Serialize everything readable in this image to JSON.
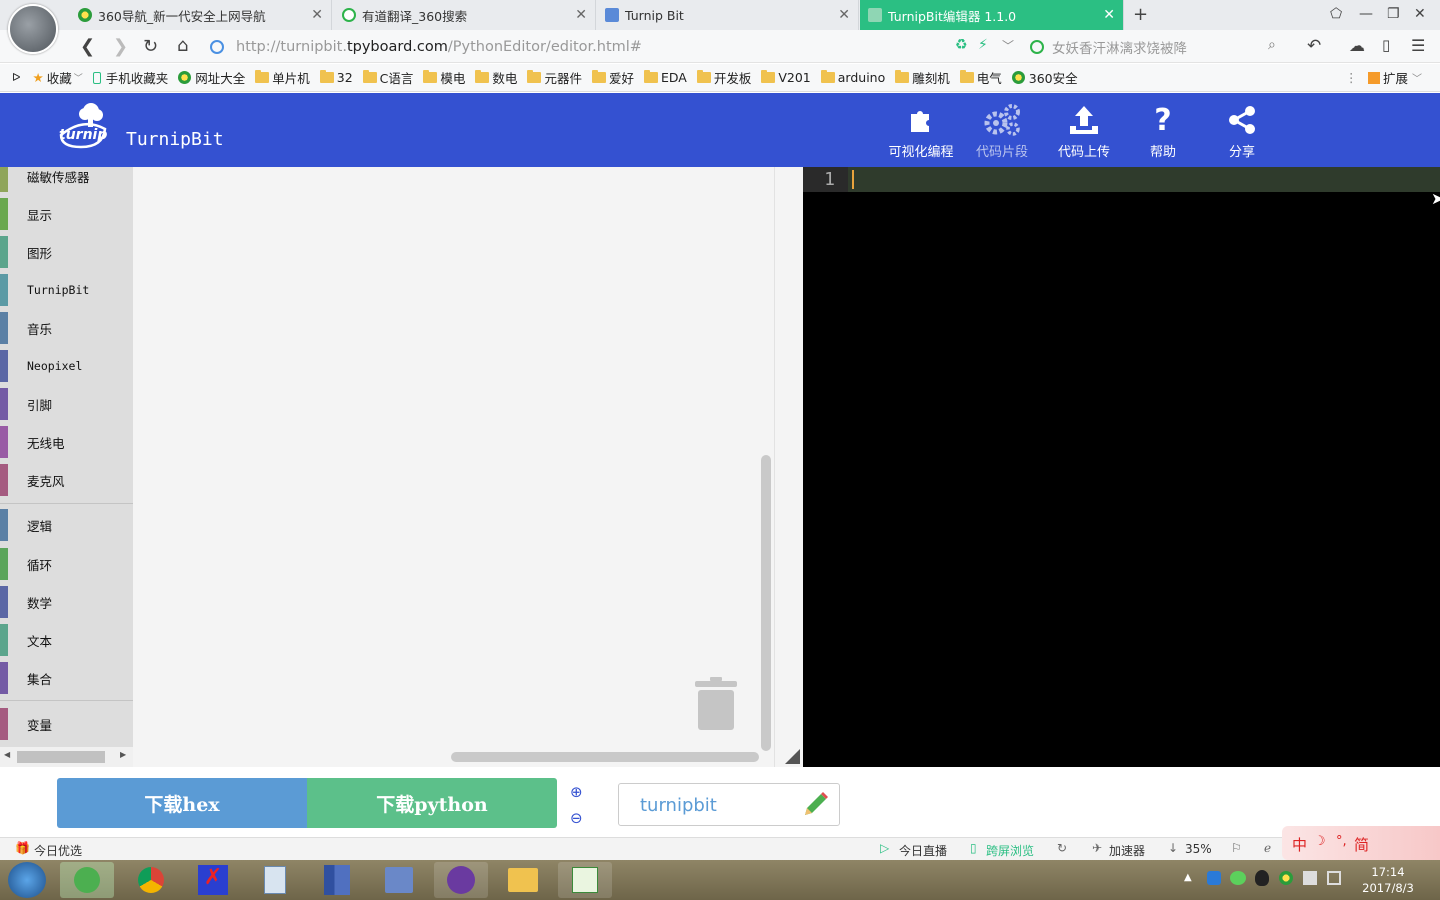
{
  "browser": {
    "tabs": [
      {
        "title": "360导航_新一代安全上网导航",
        "active": false
      },
      {
        "title": "有道翻译_360搜索",
        "active": false
      },
      {
        "title": "Turnip Bit",
        "active": false
      },
      {
        "title": "TurnipBit编辑器 1.1.0",
        "active": true
      }
    ],
    "new_tab": "+",
    "url_prefix": "http://turnipbit.",
    "url_host": "tpyboard.com",
    "url_path": "/PythonEditor/editor.html#",
    "search_placeholder": "女妖香汗淋漓求饶被降",
    "bookmarks": [
      {
        "label": "收藏",
        "type": "star"
      },
      {
        "label": "手机收藏夹",
        "type": "phone"
      },
      {
        "label": "网址大全",
        "type": "360"
      },
      {
        "label": "单片机",
        "type": "folder"
      },
      {
        "label": "32",
        "type": "folder"
      },
      {
        "label": "C语言",
        "type": "folder"
      },
      {
        "label": "模电",
        "type": "folder"
      },
      {
        "label": "数电",
        "type": "folder"
      },
      {
        "label": "元器件",
        "type": "folder"
      },
      {
        "label": "爱好",
        "type": "folder"
      },
      {
        "label": "EDA",
        "type": "folder"
      },
      {
        "label": "开发板",
        "type": "folder"
      },
      {
        "label": "V201",
        "type": "folder"
      },
      {
        "label": "arduino",
        "type": "folder"
      },
      {
        "label": "雕刻机",
        "type": "folder"
      },
      {
        "label": "电气",
        "type": "folder"
      },
      {
        "label": "360安全",
        "type": "360"
      }
    ],
    "extensions_label": "扩展"
  },
  "app": {
    "logo_text": "turnip",
    "title": "TurnipBit",
    "header_buttons": [
      {
        "label": "可视化编程",
        "icon": "puzzle-icon",
        "enabled": true
      },
      {
        "label": "代码片段",
        "icon": "gears-icon",
        "enabled": false
      },
      {
        "label": "代码上传",
        "icon": "upload-icon",
        "enabled": true
      },
      {
        "label": "帮助",
        "icon": "question-icon",
        "enabled": true
      },
      {
        "label": "分享",
        "icon": "share-icon",
        "enabled": true
      }
    ],
    "categories": [
      {
        "label": "磁敏传感器",
        "color": "#8fa55a"
      },
      {
        "label": "显示",
        "color": "#6aa84f"
      },
      {
        "label": "图形",
        "color": "#5ba58c"
      },
      {
        "label": "TurnipBit",
        "color": "#5b9aa5"
      },
      {
        "label": "音乐",
        "color": "#5b80a5"
      },
      {
        "label": "Neopixel",
        "color": "#5b67a5"
      },
      {
        "label": "引脚",
        "color": "#745ba5"
      },
      {
        "label": "无线电",
        "color": "#995ba5"
      },
      {
        "label": "麦克风",
        "color": "#a55b80"
      },
      {
        "label": "逻辑",
        "color": "#5b80a5"
      },
      {
        "label": "循环",
        "color": "#5ba55b"
      },
      {
        "label": "数学",
        "color": "#5b67a5"
      },
      {
        "label": "文本",
        "color": "#5ba58c"
      },
      {
        "label": "集合",
        "color": "#745ba5"
      },
      {
        "label": "变量",
        "color": "#a55b80"
      }
    ],
    "line_number": "1",
    "download_hex": "下载hex",
    "download_python": "下载python",
    "project_name": "turnipbit"
  },
  "status_bar": {
    "left": "今日优选",
    "live": "今日直播",
    "cross_screen": "跨屏浏览",
    "accelerator": "加速器",
    "percent": "35%",
    "ime_zh": "中",
    "ime_jian": "简"
  },
  "taskbar": {
    "time": "17:14",
    "date": "2017/8/3"
  }
}
